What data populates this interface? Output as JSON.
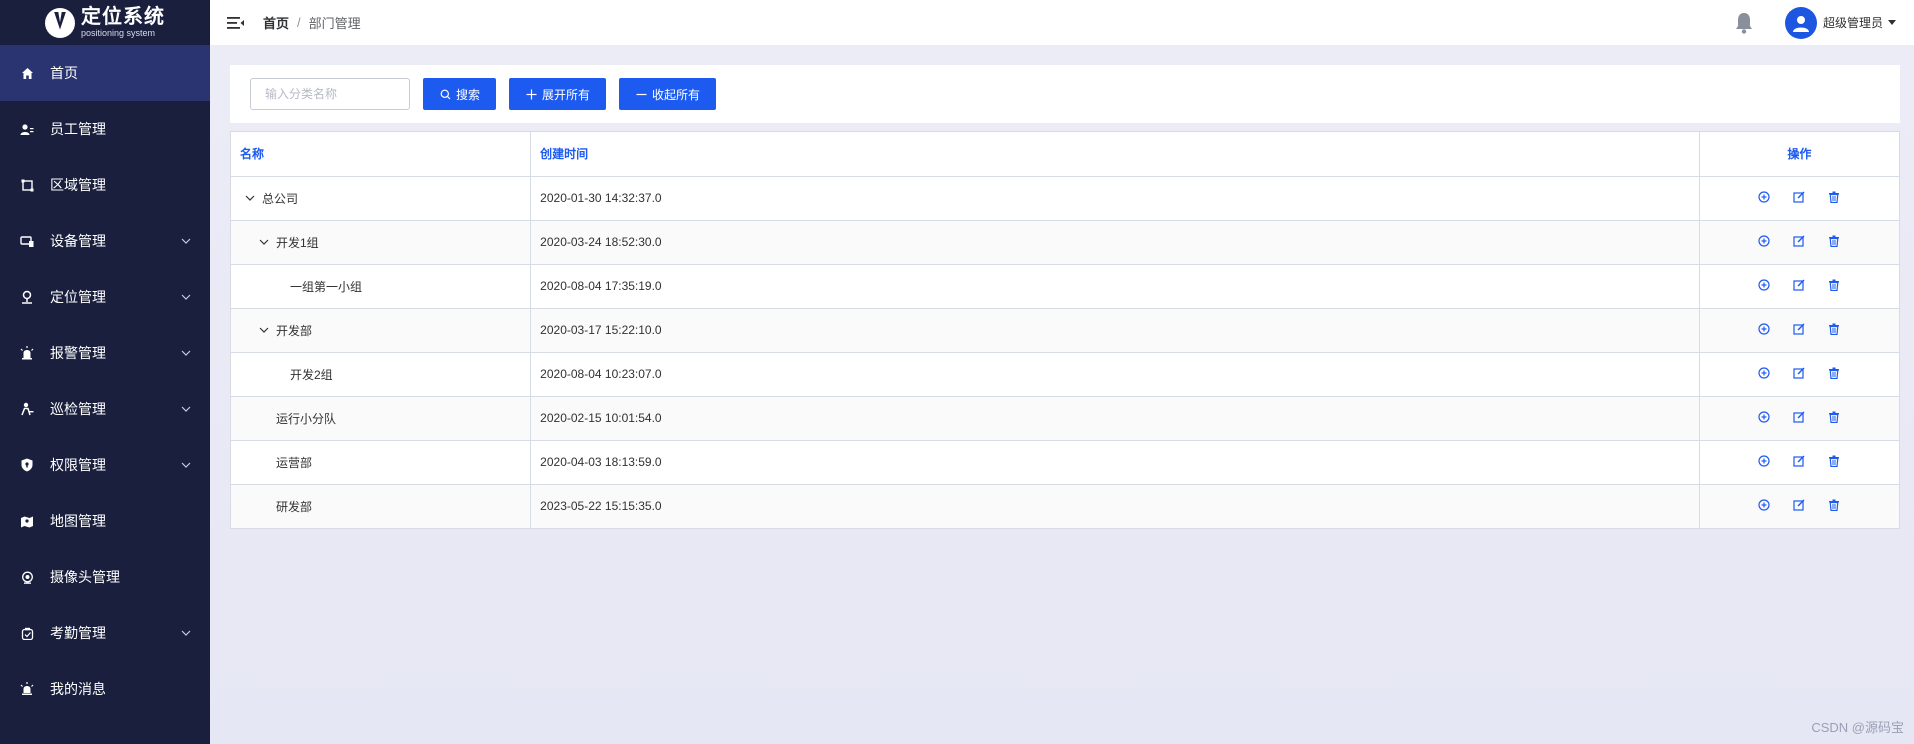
{
  "app": {
    "title": "定位系统",
    "subtitle": "positioning system"
  },
  "sidebar": {
    "items": [
      {
        "label": "首页",
        "icon": "home-icon",
        "active": true,
        "chevron": false
      },
      {
        "label": "员工管理",
        "icon": "users-icon",
        "active": false,
        "chevron": false
      },
      {
        "label": "区域管理",
        "icon": "area-icon",
        "active": false,
        "chevron": false
      },
      {
        "label": "设备管理",
        "icon": "device-icon",
        "active": false,
        "chevron": true
      },
      {
        "label": "定位管理",
        "icon": "location-icon",
        "active": false,
        "chevron": true
      },
      {
        "label": "报警管理",
        "icon": "alarm-icon",
        "active": false,
        "chevron": true
      },
      {
        "label": "巡检管理",
        "icon": "patrol-icon",
        "active": false,
        "chevron": true
      },
      {
        "label": "权限管理",
        "icon": "shield-icon",
        "active": false,
        "chevron": true
      },
      {
        "label": "地图管理",
        "icon": "map-icon",
        "active": false,
        "chevron": false
      },
      {
        "label": "摄像头管理",
        "icon": "camera-icon",
        "active": false,
        "chevron": false
      },
      {
        "label": "考勤管理",
        "icon": "attendance-icon",
        "active": false,
        "chevron": true
      },
      {
        "label": "我的消息",
        "icon": "message-icon",
        "active": false,
        "chevron": false
      }
    ]
  },
  "header": {
    "breadcrumb_home": "首页",
    "breadcrumb_sep": "/",
    "breadcrumb_current": "部门管理",
    "user_name": "超级管理员"
  },
  "toolbar": {
    "search_placeholder": "输入分类名称",
    "search_value": "",
    "search_button": "搜索",
    "expand_all_button": "展开所有",
    "collapse_all_button": "收起所有"
  },
  "table": {
    "headers": {
      "name": "名称",
      "time": "创建时间",
      "ops": "操作"
    },
    "rows": [
      {
        "name": "总公司",
        "time": "2020-01-30 14:32:37.0",
        "level": 0,
        "expandable": true
      },
      {
        "name": "开发1组",
        "time": "2020-03-24 18:52:30.0",
        "level": 1,
        "expandable": true
      },
      {
        "name": "一组第一小组",
        "time": "2020-08-04 17:35:19.0",
        "level": 2,
        "expandable": false
      },
      {
        "name": "开发部",
        "time": "2020-03-17 15:22:10.0",
        "level": 1,
        "expandable": true
      },
      {
        "name": "开发2组",
        "time": "2020-08-04 10:23:07.0",
        "level": 2,
        "expandable": false
      },
      {
        "name": "运行小分队",
        "time": "2020-02-15 10:01:54.0",
        "level": 1,
        "expandable": false
      },
      {
        "name": "运营部",
        "time": "2020-04-03 18:13:59.0",
        "level": 1,
        "expandable": false
      },
      {
        "name": "研发部",
        "time": "2023-05-22 15:15:35.0",
        "level": 1,
        "expandable": false
      }
    ]
  },
  "watermark": "CSDN @源码宝",
  "colors": {
    "sidebar_bg": "#1a1f3e",
    "sidebar_active": "#2a3470",
    "primary": "#1d5bf0"
  }
}
